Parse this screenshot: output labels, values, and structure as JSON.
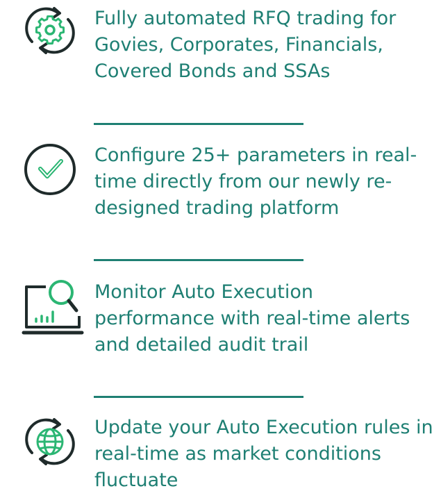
{
  "colors": {
    "text": "#1e7f73",
    "icon_dark": "#1f2b2b",
    "icon_accent": "#2bb673"
  },
  "features": [
    {
      "icon": "gear-cycle-icon",
      "text": "Fully automated RFQ trading for Govies, Corporates, Financials, Covered Bonds and SSAs"
    },
    {
      "icon": "check-circle-icon",
      "text": "Configure 25+ parameters in real-time directly from our newly re-designed trading platform"
    },
    {
      "icon": "monitor-magnifier-icon",
      "text": "Monitor Auto Execution performance with real-time alerts and detailed audit trail"
    },
    {
      "icon": "globe-cycle-icon",
      "text": "Update your Auto Execution rules in real-time as market conditions fluctuate"
    }
  ]
}
